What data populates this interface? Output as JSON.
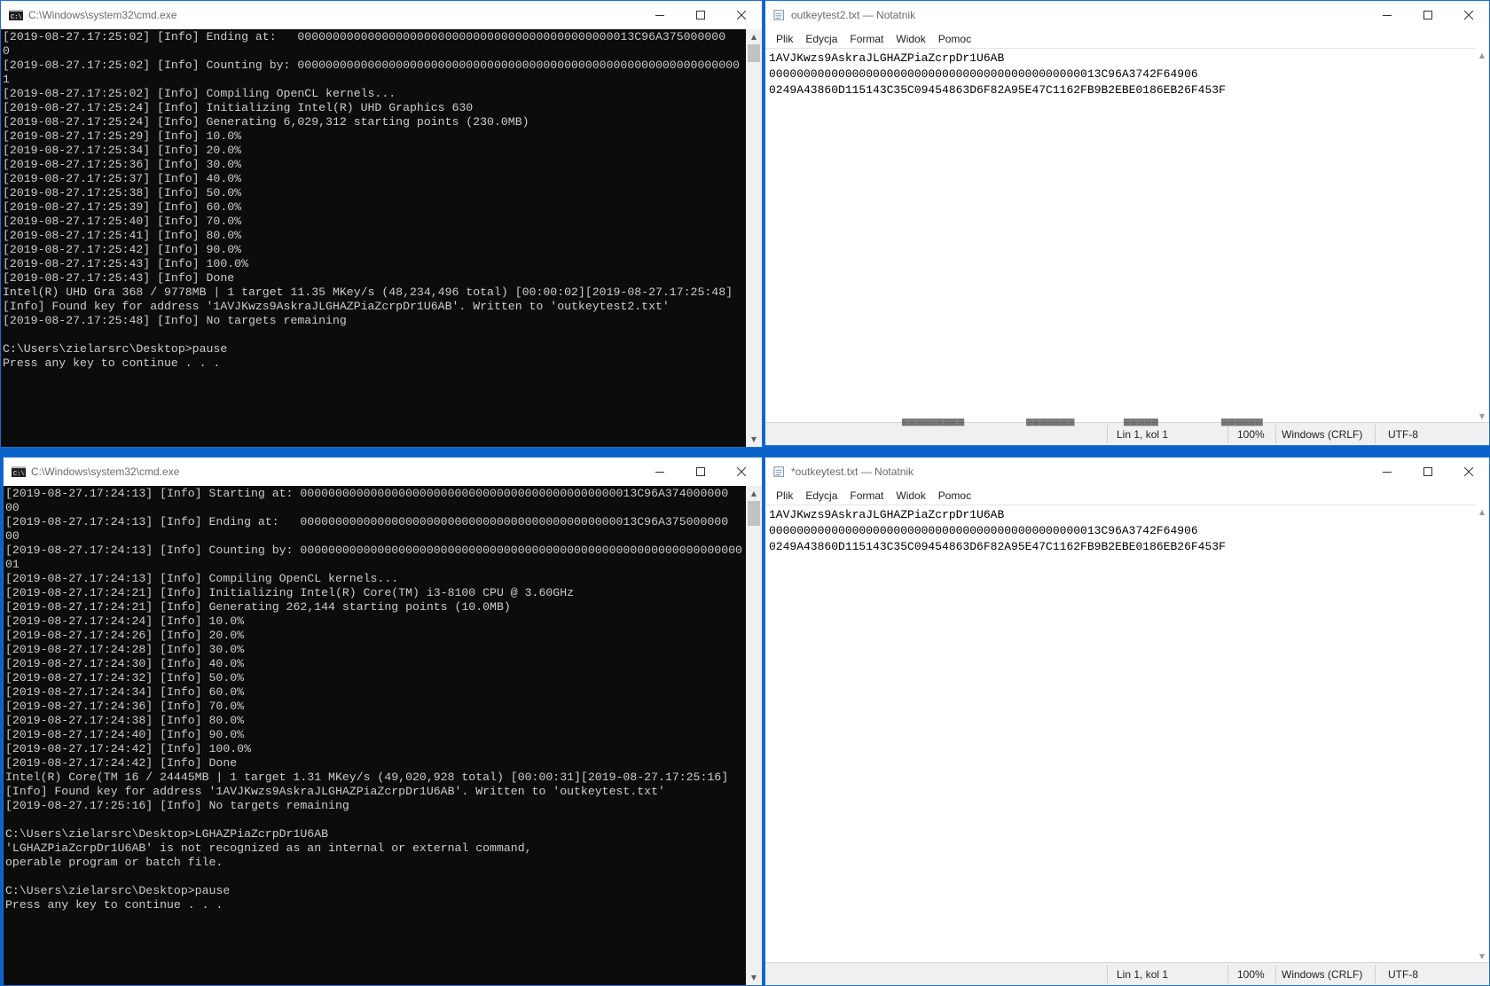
{
  "colors": {
    "desktop": "#0a63c9",
    "console_bg": "#0c0c0c",
    "console_text": "#cccccc",
    "window_border": "#1c6fd1"
  },
  "cmd_top": {
    "title": "C:\\Windows\\system32\\cmd.exe",
    "lines": [
      "[2019-08-27.17:25:02] [Info] Ending at:   000000000000000000000000000000000000000000000013C96A375000000",
      "0",
      "[2019-08-27.17:25:02] [Info] Counting by: 000000000000000000000000000000000000000000000000000000000000000",
      "1",
      "[2019-08-27.17:25:02] [Info] Compiling OpenCL kernels...",
      "[2019-08-27.17:25:24] [Info] Initializing Intel(R) UHD Graphics 630",
      "[2019-08-27.17:25:24] [Info] Generating 6,029,312 starting points (230.0MB)",
      "[2019-08-27.17:25:29] [Info] 10.0%",
      "[2019-08-27.17:25:34] [Info] 20.0%",
      "[2019-08-27.17:25:36] [Info] 30.0%",
      "[2019-08-27.17:25:37] [Info] 40.0%",
      "[2019-08-27.17:25:38] [Info] 50.0%",
      "[2019-08-27.17:25:39] [Info] 60.0%",
      "[2019-08-27.17:25:40] [Info] 70.0%",
      "[2019-08-27.17:25:41] [Info] 80.0%",
      "[2019-08-27.17:25:42] [Info] 90.0%",
      "[2019-08-27.17:25:43] [Info] 100.0%",
      "[2019-08-27.17:25:43] [Info] Done",
      "Intel(R) UHD Gra 368 / 9778MB | 1 target 11.35 MKey/s (48,234,496 total) [00:00:02][2019-08-27.17:25:48]",
      "[Info] Found key for address '1AVJKwzs9AskraJLGHAZPiaZcrpDr1U6AB'. Written to 'outkeytest2.txt'",
      "[2019-08-27.17:25:48] [Info] No targets remaining",
      "",
      "C:\\Users\\zielarsrc\\Desktop>pause",
      "Press any key to continue . . ."
    ]
  },
  "cmd_bottom": {
    "title": "C:\\Windows\\system32\\cmd.exe",
    "lines": [
      "[2019-08-27.17:24:13] [Info] Starting at: 000000000000000000000000000000000000000000000013C96A374000000",
      "00",
      "[2019-08-27.17:24:13] [Info] Ending at:   000000000000000000000000000000000000000000000013C96A375000000",
      "00",
      "[2019-08-27.17:24:13] [Info] Counting by: 000000000000000000000000000000000000000000000000000000000000000",
      "01",
      "[2019-08-27.17:24:13] [Info] Compiling OpenCL kernels...",
      "[2019-08-27.17:24:21] [Info] Initializing Intel(R) Core(TM) i3-8100 CPU @ 3.60GHz",
      "[2019-08-27.17:24:21] [Info] Generating 262,144 starting points (10.0MB)",
      "[2019-08-27.17:24:24] [Info] 10.0%",
      "[2019-08-27.17:24:26] [Info] 20.0%",
      "[2019-08-27.17:24:28] [Info] 30.0%",
      "[2019-08-27.17:24:30] [Info] 40.0%",
      "[2019-08-27.17:24:32] [Info] 50.0%",
      "[2019-08-27.17:24:34] [Info] 60.0%",
      "[2019-08-27.17:24:36] [Info] 70.0%",
      "[2019-08-27.17:24:38] [Info] 80.0%",
      "[2019-08-27.17:24:40] [Info] 90.0%",
      "[2019-08-27.17:24:42] [Info] 100.0%",
      "[2019-08-27.17:24:42] [Info] Done",
      "Intel(R) Core(TM 16 / 24445MB | 1 target 1.31 MKey/s (49,020,928 total) [00:00:31][2019-08-27.17:25:16]",
      "[Info] Found key for address '1AVJKwzs9AskraJLGHAZPiaZcrpDr1U6AB'. Written to 'outkeytest.txt'",
      "[2019-08-27.17:25:16] [Info] No targets remaining",
      "",
      "C:\\Users\\zielarsrc\\Desktop>LGHAZPiaZcrpDr1U6AB",
      "'LGHAZPiaZcrpDr1U6AB' is not recognized as an internal or external command,",
      "operable program or batch file.",
      "",
      "C:\\Users\\zielarsrc\\Desktop>pause",
      "Press any key to continue . . ."
    ]
  },
  "notepad_top": {
    "title": "outkeytest2.txt — Notatnik",
    "menu": [
      "Plik",
      "Edycja",
      "Format",
      "Widok",
      "Pomoc"
    ],
    "lines": [
      "1AVJKwzs9AskraJLGHAZPiaZcrpDr1U6AB",
      "000000000000000000000000000000000000000000000013C96A3742F64906",
      "0249A43860D115143C35C09454863D6F82A95E47C1162FB9B2EBE0186EB26F453F"
    ],
    "status": {
      "position": "Lin 1, kol 1",
      "zoom": "100%",
      "eol": "Windows (CRLF)",
      "encoding": "UTF-8"
    }
  },
  "notepad_bottom": {
    "title": "*outkeytest.txt — Notatnik",
    "menu": [
      "Plik",
      "Edycja",
      "Format",
      "Widok",
      "Pomoc"
    ],
    "lines": [
      "1AVJKwzs9AskraJLGHAZPiaZcrpDr1U6AB",
      "000000000000000000000000000000000000000000000013C96A3742F64906",
      "0249A43860D115143C35C09454863D6F82A95E47C1162FB9B2EBE0186EB26F453F"
    ],
    "status": {
      "position": "Lin 1, kol 1",
      "zoom": "100%",
      "eol": "Windows (CRLF)",
      "encoding": "UTF-8"
    }
  }
}
